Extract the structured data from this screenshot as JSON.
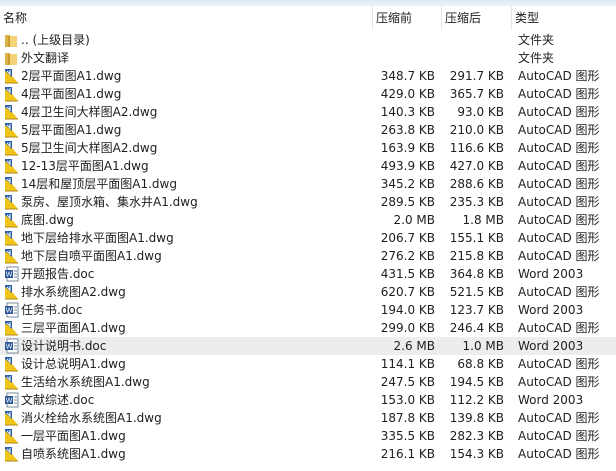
{
  "columns": {
    "name": "名称",
    "size": "压缩前",
    "compressed": "压缩后",
    "type": "类型"
  },
  "selected_index": 17,
  "rows": [
    {
      "icon": "folder",
      "name": ".. (上级目录)",
      "size": "",
      "compressed": "",
      "type": "文件夹"
    },
    {
      "icon": "folder",
      "name": "外文翻译",
      "size": "",
      "compressed": "",
      "type": "文件夹"
    },
    {
      "icon": "dwg",
      "name": "2层平面图A1.dwg",
      "size": "348.7 KB",
      "compressed": "291.7 KB",
      "type": "AutoCAD 图形"
    },
    {
      "icon": "dwg",
      "name": "4层平面图A1.dwg",
      "size": "429.0 KB",
      "compressed": "365.7 KB",
      "type": "AutoCAD 图形"
    },
    {
      "icon": "dwg",
      "name": "4层卫生间大样图A2.dwg",
      "size": "140.3 KB",
      "compressed": "93.0 KB",
      "type": "AutoCAD 图形"
    },
    {
      "icon": "dwg",
      "name": "5层平面图A1.dwg",
      "size": "263.8 KB",
      "compressed": "210.0 KB",
      "type": "AutoCAD 图形"
    },
    {
      "icon": "dwg",
      "name": "5层卫生间大样图A2.dwg",
      "size": "163.9 KB",
      "compressed": "116.6 KB",
      "type": "AutoCAD 图形"
    },
    {
      "icon": "dwg",
      "name": "12-13层平面图A1.dwg",
      "size": "493.9 KB",
      "compressed": "427.0 KB",
      "type": "AutoCAD 图形"
    },
    {
      "icon": "dwg",
      "name": "14层和屋顶层平面图A1.dwg",
      "size": "345.2 KB",
      "compressed": "288.6 KB",
      "type": "AutoCAD 图形"
    },
    {
      "icon": "dwg",
      "name": "泵房、屋顶水箱、集水井A1.dwg",
      "size": "289.5 KB",
      "compressed": "235.3 KB",
      "type": "AutoCAD 图形"
    },
    {
      "icon": "dwg",
      "name": "底图.dwg",
      "size": "2.0 MB",
      "compressed": "1.8 MB",
      "type": "AutoCAD 图形"
    },
    {
      "icon": "dwg",
      "name": "地下层给排水平面图A1.dwg",
      "size": "206.7 KB",
      "compressed": "155.1 KB",
      "type": "AutoCAD 图形"
    },
    {
      "icon": "dwg",
      "name": "地下层自喷平面图A1.dwg",
      "size": "276.2 KB",
      "compressed": "215.8 KB",
      "type": "AutoCAD 图形"
    },
    {
      "icon": "doc",
      "name": "开题报告.doc",
      "size": "431.5 KB",
      "compressed": "364.8 KB",
      "type": "Word 2003"
    },
    {
      "icon": "dwg",
      "name": "排水系统图A2.dwg",
      "size": "620.7 KB",
      "compressed": "521.5 KB",
      "type": "AutoCAD 图形"
    },
    {
      "icon": "doc",
      "name": "任务书.doc",
      "size": "194.0 KB",
      "compressed": "123.7 KB",
      "type": "Word 2003"
    },
    {
      "icon": "dwg",
      "name": "三层平面图A1.dwg",
      "size": "299.0 KB",
      "compressed": "246.4 KB",
      "type": "AutoCAD 图形"
    },
    {
      "icon": "doc",
      "name": "设计说明书.doc",
      "size": "2.6 MB",
      "compressed": "1.0 MB",
      "type": "Word 2003"
    },
    {
      "icon": "dwg",
      "name": "设计总说明A1.dwg",
      "size": "114.1 KB",
      "compressed": "68.8 KB",
      "type": "AutoCAD 图形"
    },
    {
      "icon": "dwg",
      "name": "生活给水系统图A1.dwg",
      "size": "247.5 KB",
      "compressed": "194.5 KB",
      "type": "AutoCAD 图形"
    },
    {
      "icon": "doc",
      "name": "文献综述.doc",
      "size": "153.0 KB",
      "compressed": "112.2 KB",
      "type": "Word 2003"
    },
    {
      "icon": "dwg",
      "name": "消火栓给水系统图A1.dwg",
      "size": "187.8 KB",
      "compressed": "139.8 KB",
      "type": "AutoCAD 图形"
    },
    {
      "icon": "dwg",
      "name": "一层平面图A1.dwg",
      "size": "335.5 KB",
      "compressed": "282.3 KB",
      "type": "AutoCAD 图形"
    },
    {
      "icon": "dwg",
      "name": "自喷系统图A1.dwg",
      "size": "216.1 KB",
      "compressed": "154.3 KB",
      "type": "AutoCAD 图形"
    }
  ]
}
